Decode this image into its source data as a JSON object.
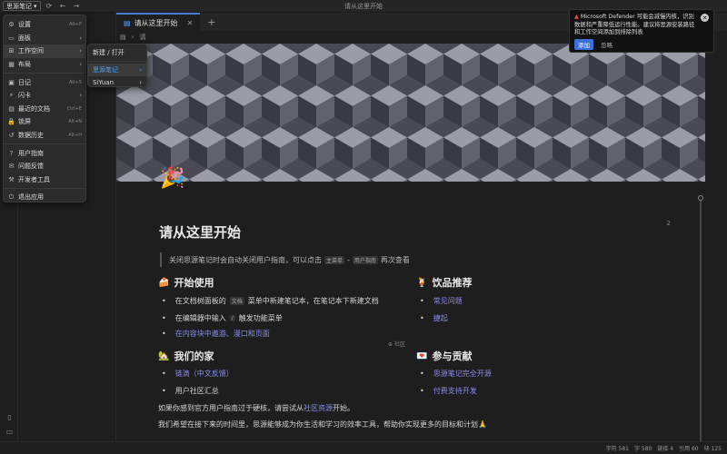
{
  "topbar": {
    "workspace_btn": "思源笔记",
    "window_title": "请从这里开始"
  },
  "tabs": [
    {
      "label": "请从这里开始"
    }
  ],
  "tree": {
    "lines": [
      "≡",
      "∨"
    ]
  },
  "breadcrumb": {
    "doc_label": "请"
  },
  "menu": {
    "items": [
      {
        "label": "设置",
        "key": "Alt+P",
        "icon": "gear-icon",
        "glyph": "⚙"
      },
      {
        "label": "面板",
        "key": "",
        "icon": "panel-icon",
        "glyph": "▭",
        "arrow": "›"
      },
      {
        "label": "工作空间",
        "key": "",
        "icon": "workspace-icon",
        "glyph": "⊞",
        "arrow": "›",
        "active": true
      },
      {
        "label": "布局",
        "key": "",
        "icon": "layout-icon",
        "glyph": "▦",
        "arrow": "›"
      },
      {
        "label": "日记",
        "key": "Alt+5",
        "icon": "calendar-icon",
        "glyph": "▣"
      },
      {
        "label": "闪卡",
        "key": "",
        "icon": "flashcard-icon",
        "glyph": "⚡",
        "arrow": "›"
      },
      {
        "label": "最近的文档",
        "key": "Ctrl+E",
        "icon": "document-icon",
        "glyph": "▤"
      },
      {
        "label": "锁屏",
        "key": "Alt+N",
        "icon": "lock-icon",
        "glyph": "🔒"
      },
      {
        "label": "数据历史",
        "key": "Alt+H",
        "icon": "history-icon",
        "glyph": "↺"
      },
      {
        "label": "用户指南",
        "key": "",
        "icon": "guide-icon",
        "glyph": "?"
      },
      {
        "label": "问题反馈",
        "key": "",
        "icon": "feedback-icon",
        "glyph": "✉"
      },
      {
        "label": "开发者工具",
        "key": "",
        "icon": "devtools-icon",
        "glyph": "⚒"
      },
      {
        "label": "退出应用",
        "key": "",
        "icon": "exit-icon",
        "glyph": "⏻"
      }
    ]
  },
  "submenu": {
    "open": "新建 / 打开",
    "ws1": "思源笔记",
    "ws2": "SiYuan",
    "arrow": "›"
  },
  "notification": {
    "title": "Microsoft Defender 可能会减慢内核，识别数据和严重降低运行性能。建议将思源安装路径和工作空间添加到排除列表",
    "add": "添加",
    "ignore": "忽略",
    "close": "✕"
  },
  "doc": {
    "title": "请从这里开始",
    "intro_pre": "关闭思源笔记时会自动关闭用户指南，可以点击",
    "intro_kbd1": "主菜单",
    "intro_mid": "-",
    "intro_kbd2": "用户指南",
    "intro_post": "再次查看",
    "block_count": "2",
    "sections": {
      "start": {
        "title": "开始使用",
        "emoji": "🍰"
      },
      "drinks": {
        "title": "饮品推荐",
        "emoji": "🍹"
      },
      "home": {
        "title": "我们的家",
        "emoji": "🏡"
      },
      "contribute": {
        "title": "参与贡献",
        "emoji": "💌"
      }
    },
    "start_items": [
      {
        "pre": "在文档树面板的",
        "kbd": "文档",
        "post": "菜单中新建笔记本，在笔记本下新建文档"
      },
      {
        "pre": "在编辑器中输入",
        "kbd": "/",
        "post": "触发功能菜单"
      },
      {
        "link": "在内容块中遨游、漫口和页面"
      }
    ],
    "drink_items": [
      {
        "link": "常见问题"
      },
      {
        "link": "捷起"
      }
    ],
    "home_items": [
      {
        "link": "链滴（中文反馈）"
      },
      {
        "link": "用户社区汇总"
      }
    ],
    "contribute_items": [
      {
        "link": "思源笔记完全开源"
      },
      {
        "link": "付费支持开发"
      }
    ],
    "para1_pre": "如果你感到官方用户指南过于硬核，请尝试从",
    "para1_link": "社区资源",
    "para1_post": "开始。",
    "para2": "我们希望在接下来的时间里，思源能够成为你生活和学习的效率工具，帮助你实现更多的目标和计划🙏",
    "row_label": "社区"
  },
  "statusbar": {
    "chars": "字符 581",
    "words": "字 580",
    "links": "链接 4",
    "refs": "引用 60",
    "blocks": "块 125"
  },
  "colors": {
    "accent": "#4a7bd0",
    "link": "#8a8cf0",
    "notif_button": "#3c6fd8"
  }
}
